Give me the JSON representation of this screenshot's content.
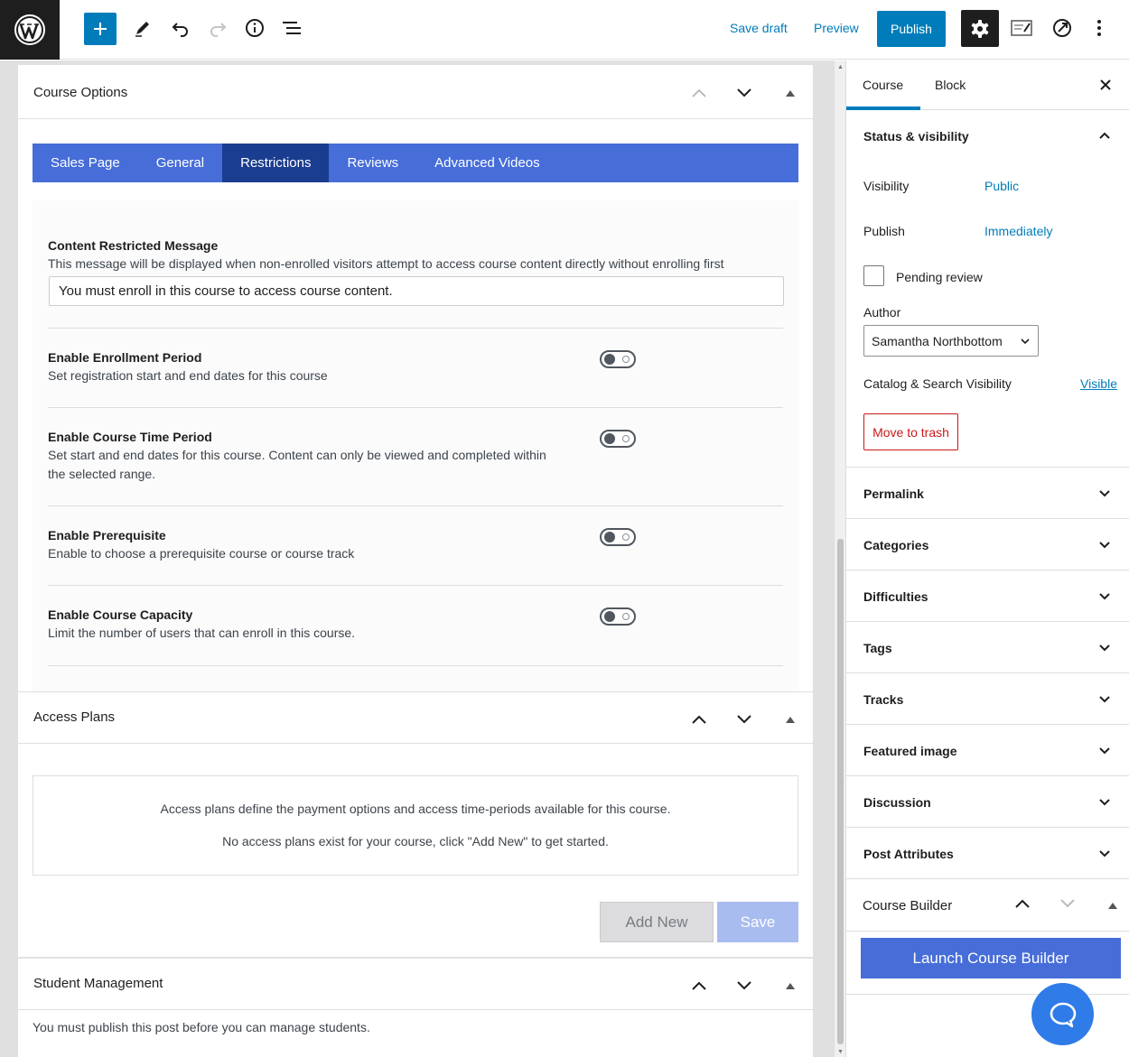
{
  "topbar": {
    "save_draft": "Save draft",
    "preview": "Preview",
    "publish": "Publish"
  },
  "course_options": {
    "title": "Course Options",
    "tabs": [
      {
        "label": "Sales Page"
      },
      {
        "label": "General"
      },
      {
        "label": "Restrictions",
        "active": true
      },
      {
        "label": "Reviews"
      },
      {
        "label": "Advanced Videos"
      }
    ],
    "content_restricted": {
      "title": "Content Restricted Message",
      "desc": "This message will be displayed when non-enrolled visitors attempt to access course content directly without enrolling first",
      "value": "You must enroll in this course to access course content."
    },
    "enrollment_period": {
      "title": "Enable Enrollment Period",
      "desc": "Set registration start and end dates for this course",
      "enabled": false
    },
    "time_period": {
      "title": "Enable Course Time Period",
      "desc_line1": "Set start and end dates for this course. Content can only be viewed and completed within",
      "desc_line2": "the selected range.",
      "enabled": false
    },
    "prerequisite": {
      "title": "Enable Prerequisite",
      "desc": "Enable to choose a prerequisite course or course track",
      "enabled": false
    },
    "capacity": {
      "title": "Enable Course Capacity",
      "desc": "Limit the number of users that can enroll in this course.",
      "enabled": false
    }
  },
  "access_plans": {
    "title": "Access Plans",
    "line1": "Access plans define the payment options and access time-periods available for this course.",
    "line2": "No access plans exist for your course, click \"Add New\" to get started.",
    "add_new": "Add New",
    "save": "Save"
  },
  "student_management": {
    "title": "Student Management",
    "message": "You must publish this post before you can manage students."
  },
  "sidebar": {
    "tab_course": "Course",
    "tab_block": "Block",
    "status_visibility": {
      "title": "Status & visibility",
      "visibility_label": "Visibility",
      "visibility_value": "Public",
      "publish_label": "Publish",
      "publish_value": "Immediately",
      "pending_review": "Pending review",
      "author_label": "Author",
      "author_value": "Samantha Northbottom",
      "catalog_label": "Catalog & Search Visibility",
      "catalog_value": "Visible",
      "move_to_trash": "Move to trash"
    },
    "sections": [
      {
        "title": "Permalink"
      },
      {
        "title": "Categories"
      },
      {
        "title": "Difficulties"
      },
      {
        "title": "Tags"
      },
      {
        "title": "Tracks"
      },
      {
        "title": "Featured image"
      },
      {
        "title": "Discussion"
      },
      {
        "title": "Post Attributes"
      }
    ],
    "course_builder": {
      "title": "Course Builder",
      "launch": "Launch Course Builder"
    }
  },
  "colors": {
    "wp_blue": "#007cba",
    "tab_blue": "#466dd8",
    "tab_active": "#1b3d8f",
    "trash_red": "#cc1818",
    "help_blue": "#2f7be8"
  }
}
